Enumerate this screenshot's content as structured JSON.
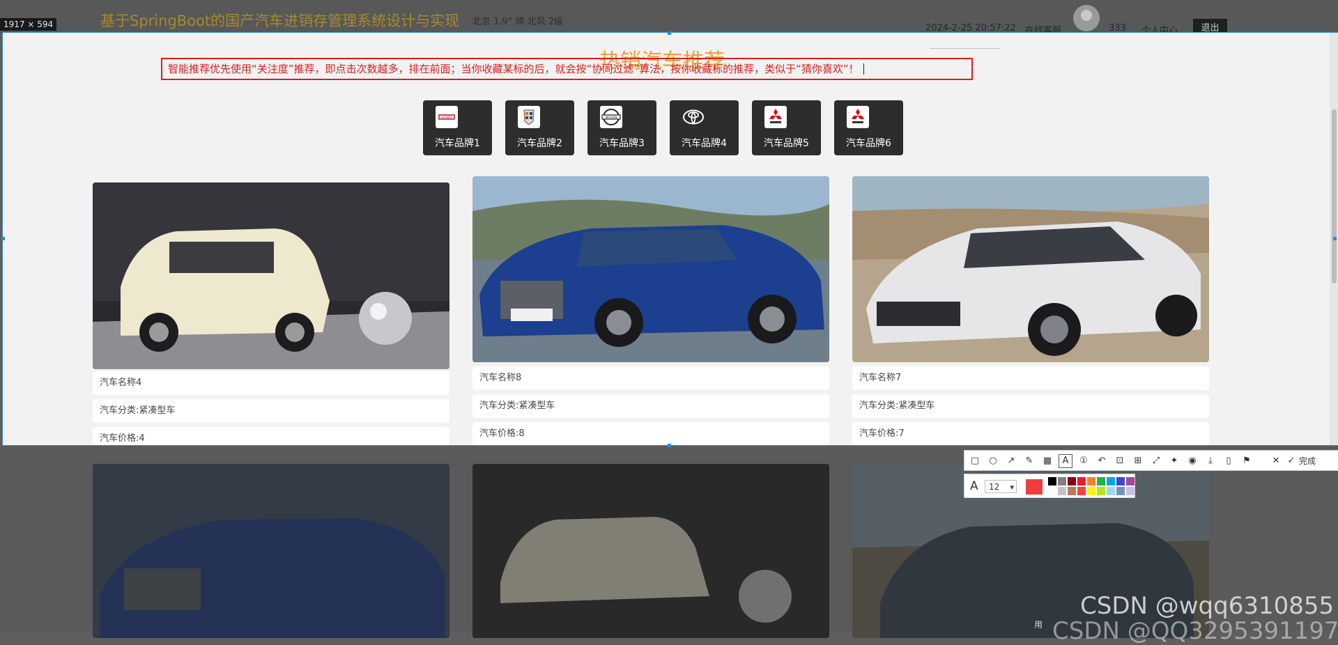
{
  "header": {
    "site_title": "基于SpringBoot的国产汽车进销存管理系统设计与实现",
    "weather": "北京  1.9°  晴  北风  2级",
    "datetime": "2024-2-25 20:57:22",
    "online_service": "在线客服",
    "username": "333",
    "user_center": "个人中心",
    "logout": "退出"
  },
  "capture": {
    "size_label": "1917 × 594"
  },
  "recommend": {
    "title": "热销汽车推荐",
    "annotation": "智能推荐优先使用“关注度”推荐，即点击次数越多，排在前面；当你收藏某标的后，就会按“协同过滤”算法，按你收藏标的推荐，类似于“猜你喜欢”！"
  },
  "brands": [
    {
      "label": "汽车品牌1",
      "icon": "honda-logo-icon"
    },
    {
      "label": "汽车品牌2",
      "icon": "cadillac-logo-icon"
    },
    {
      "label": "汽车品牌3",
      "icon": "nissan-logo-icon"
    },
    {
      "label": "汽车品牌4",
      "icon": "toyota-logo-icon"
    },
    {
      "label": "汽车品牌5",
      "icon": "mitsubishi-logo-icon"
    },
    {
      "label": "汽车品牌6",
      "icon": "mitsubishi-logo-icon"
    }
  ],
  "cars": [
    {
      "name": "汽车名称4",
      "category": "汽车分类:紧凑型车",
      "price": "汽车价格:4",
      "image": "kia-soul-photo"
    },
    {
      "name": "汽车名称8",
      "category": "汽车分类:紧凑型车",
      "price": "汽车价格:8",
      "image": "bentley-continental-photo"
    },
    {
      "name": "汽车名称7",
      "category": "汽车分类:紧凑型车",
      "price": "汽车价格:7",
      "image": "audi-a7-photo"
    }
  ],
  "below_cars": [
    "bentley-continental-photo",
    "kia-soul-photo",
    "subaru-outback-photo"
  ],
  "toolbar": {
    "done": "完成",
    "font_size": "12",
    "current_color": "#f03c3c",
    "swatches": [
      "#000000",
      "#7f7f7f",
      "#880015",
      "#ed1c24",
      "#ff7f27",
      "#22b14c",
      "#00a2e8",
      "#3f48cc",
      "#a349a4",
      "#ffffff",
      "#c3c3c3",
      "#b97a57",
      "#ff4040",
      "#fff200",
      "#b5e61d",
      "#99d9ea",
      "#7092be",
      "#c8bfe7"
    ]
  },
  "watermark": {
    "line1": "CSDN @wqq6310855",
    "line2": "CSDN @QQ3295391197",
    "use": "用"
  }
}
